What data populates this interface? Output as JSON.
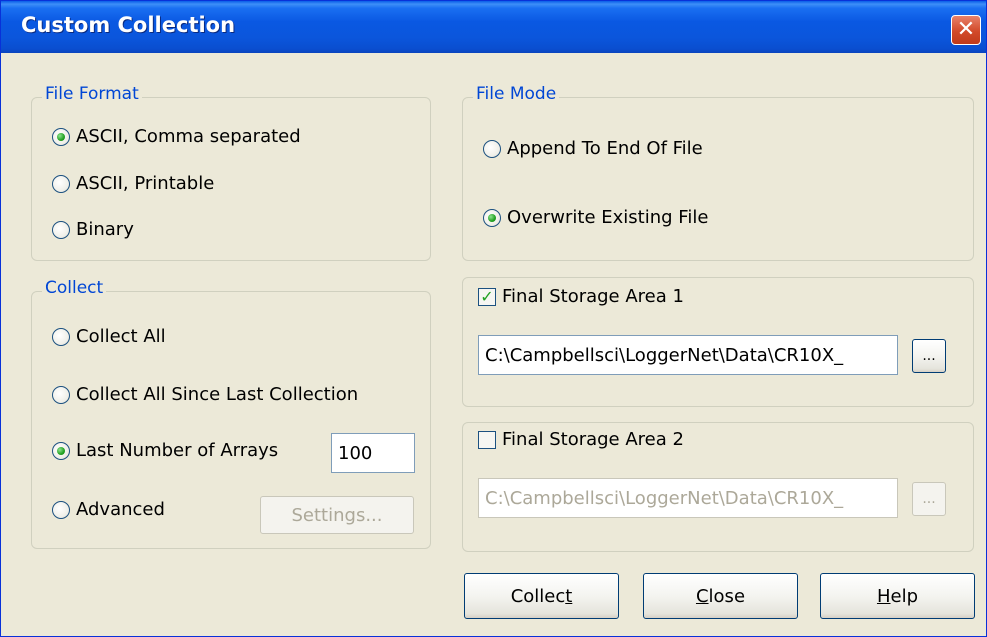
{
  "window": {
    "title": "Custom Collection",
    "close_glyph": "✕"
  },
  "file_format": {
    "legend": "File Format",
    "options": [
      {
        "label": "ASCII, Comma separated",
        "checked": true
      },
      {
        "label": "ASCII, Printable",
        "checked": false
      },
      {
        "label": "Binary",
        "checked": false
      }
    ]
  },
  "collect": {
    "legend": "Collect",
    "options": [
      {
        "label": "Collect All",
        "checked": false
      },
      {
        "label": "Collect All Since Last Collection",
        "checked": false
      },
      {
        "label": "Last Number of Arrays",
        "checked": true
      },
      {
        "label": "Advanced",
        "checked": false
      }
    ],
    "arrays_value": "100",
    "settings_label": "Settings..."
  },
  "file_mode": {
    "legend": "File Mode",
    "options": [
      {
        "label": "Append To End Of File",
        "checked": false
      },
      {
        "label": "Overwrite Existing File",
        "checked": true
      }
    ]
  },
  "final_storage_1": {
    "label": "Final Storage Area 1",
    "checked": true,
    "path": "C:\\Campbellsci\\LoggerNet\\Data\\CR10X_",
    "browse_label": "..."
  },
  "final_storage_2": {
    "label": "Final Storage Area 2",
    "checked": false,
    "path": "C:\\Campbellsci\\LoggerNet\\Data\\CR10X_",
    "browse_label": "..."
  },
  "buttons": {
    "collect_pre": "Collec",
    "collect_mnemonic": "t",
    "collect_post": "",
    "close_pre": "",
    "close_mnemonic": "C",
    "close_post": "lose",
    "help_pre": "",
    "help_mnemonic": "H",
    "help_post": "elp"
  },
  "colors": {
    "title_bar": "#0a58e2",
    "dialog_bg": "#ece9d8",
    "legend_text": "#0046d5",
    "radio_dot": "#21a121",
    "close_button": "#d24a2a"
  },
  "icons": {
    "close": "close-icon",
    "check": "checkmark-icon"
  }
}
